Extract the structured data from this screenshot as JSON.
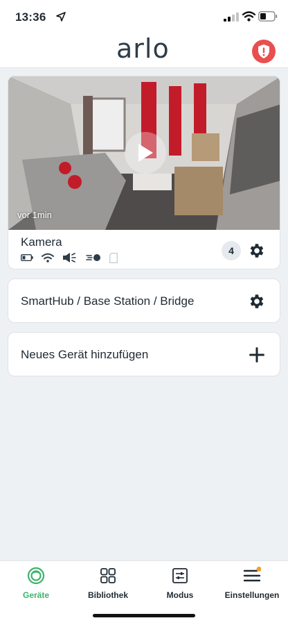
{
  "status_bar": {
    "time": "13:36"
  },
  "header": {
    "logo": "arlo"
  },
  "camera": {
    "name": "Kamera",
    "last_update": "vor 1min",
    "badge_count": "4"
  },
  "rows": {
    "smarthub": "SmartHub / Base Station / Bridge",
    "add_device": "Neues Gerät hinzufügen"
  },
  "tabs": [
    {
      "label": "Geräte",
      "icon": "devices-icon",
      "active": true
    },
    {
      "label": "Bibliothek",
      "icon": "library-icon"
    },
    {
      "label": "Modus",
      "icon": "mode-icon"
    },
    {
      "label": "Einstellungen",
      "icon": "menu-icon",
      "notification": true
    }
  ],
  "colors": {
    "accent": "#3bb36a",
    "alert": "#e94f4f",
    "notification": "#f0a033"
  }
}
